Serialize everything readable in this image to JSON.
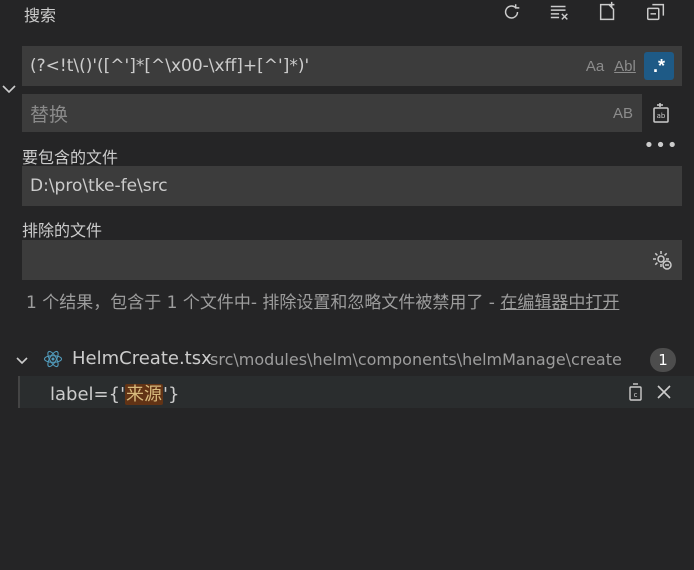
{
  "header": {
    "title": "搜索",
    "icons": [
      "refresh-icon",
      "clear-results-icon",
      "new-search-editor-icon",
      "collapse-all-icon"
    ]
  },
  "search": {
    "value": "(?<!t\\()'([^']*[^\\x00-\\xff]+[^']*)'",
    "match_case": "Aa",
    "whole_word": "Abl",
    "regex": ".*"
  },
  "replace": {
    "placeholder": "替换",
    "preserve_case": "AB"
  },
  "include": {
    "label": "要包含的文件",
    "value": "D:\\pro\\tke-fe\\src"
  },
  "exclude": {
    "label": "排除的文件",
    "value": ""
  },
  "message": {
    "text": "1 个结果，包含于 1 个文件中- 排除设置和忽略文件被禁用了 - ",
    "link": "在编辑器中打开"
  },
  "results": {
    "file": {
      "name": "HelmCreate.tsx",
      "path": "src\\modules\\helm\\components\\helmManage\\create",
      "count": "1"
    },
    "match": {
      "before": "label={'",
      "highlight": "来源",
      "after": "'}"
    }
  },
  "colors": {
    "background": "#252526",
    "input_bg": "#3c3c3c",
    "regex_active": "#1e5a86",
    "match_highlight": "#623315",
    "react_icon": "#519aba"
  }
}
